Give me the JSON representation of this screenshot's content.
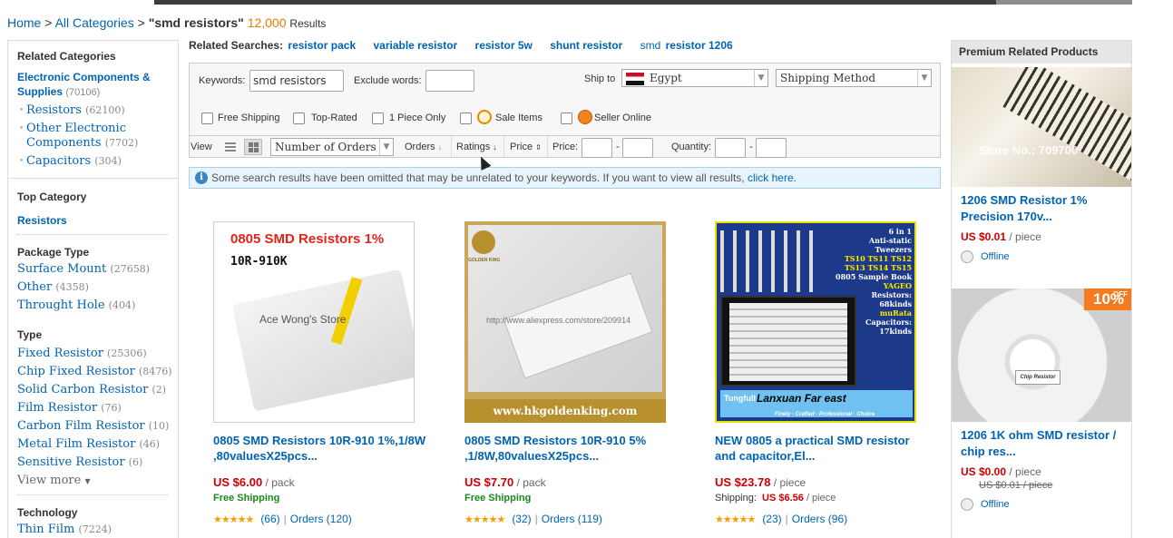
{
  "breadcrumb": {
    "home": "Home",
    "sep1": ">",
    "all_categories": "All Categories",
    "sep2": ">",
    "query": "\"smd resistors\"",
    "count": "12,000",
    "results_label": "Results"
  },
  "sidebar": {
    "related_heading": "Related Categories",
    "main_category": {
      "label": "Electronic Components & Supplies",
      "count": "(70106)"
    },
    "sub_categories": [
      {
        "label": "Resistors",
        "count": "(62100)"
      },
      {
        "label": "Other Electronic Components",
        "count": "(7702)"
      },
      {
        "label": "Capacitors",
        "count": "(304)"
      }
    ],
    "top_category_heading": "Top Category",
    "top_category": "Resistors",
    "package_heading": "Package Type",
    "package": [
      {
        "label": "Surface Mount",
        "count": "(27658)"
      },
      {
        "label": "Other",
        "count": "(4358)"
      },
      {
        "label": "Throught Hole",
        "count": "(404)"
      }
    ],
    "type_heading": "Type",
    "types": [
      {
        "label": "Fixed Resistor",
        "count": "(25306)"
      },
      {
        "label": "Chip Fixed Resistor",
        "count": "(8476)"
      },
      {
        "label": "Solid Carbon Resistor",
        "count": "(2)"
      },
      {
        "label": "Film Resistor",
        "count": "(76)"
      },
      {
        "label": "Carbon Film Resistor",
        "count": "(10)"
      },
      {
        "label": "Metal Film Resistor",
        "count": "(46)"
      },
      {
        "label": "Sensitive Resistor",
        "count": "(6)"
      }
    ],
    "view_more": "View more",
    "technology_heading": "Technology",
    "technology": [
      {
        "label": "Thin Film",
        "count": "(7224)"
      }
    ]
  },
  "related_searches": {
    "label": "Related Searches:",
    "items": [
      "resistor pack",
      "variable resistor",
      "resistor 5w",
      "shunt resistor",
      "smd",
      "resistor 1206"
    ]
  },
  "filters": {
    "keywords_label": "Keywords:",
    "keywords_value": "smd resistors",
    "exclude_label": "Exclude words:",
    "exclude_value": "",
    "ship_to_label": "Ship to",
    "ship_to_value": "Egypt",
    "shipping_method": "Shipping Method",
    "checkboxes": [
      "Free Shipping",
      "Top-Rated",
      "1 Piece Only",
      "Sale Items",
      "Seller Online"
    ],
    "view_label": "View",
    "sort_select": "Number of Orders",
    "sort_orders": "Orders",
    "sort_ratings": "Ratings",
    "sort_price": "Price",
    "price_label": "Price:",
    "dash": "-",
    "quantity_label": "Quantity:"
  },
  "notice": {
    "text": "Some search results have been omitted that may be unrelated to your keywords. If you want to view all results,",
    "link": "click here."
  },
  "products": [
    {
      "title": "0805 SMD Resistors 10R-910 1%,1/8W ,80valuesX25pcs...",
      "price": "US $6.00",
      "unit": "/ pack",
      "shipping": "Free Shipping",
      "reviews": "(66)",
      "orders": "Orders (120)",
      "img_headline": "0805 SMD Resistors 1%",
      "img_sub": "10R-910K",
      "img_watermark": "Ace Wong's Store"
    },
    {
      "title": "0805 SMD Resistors 10R-910 5% ,1/8W,80valuesX25pcs...",
      "price": "US $7.70",
      "unit": "/ pack",
      "shipping": "Free Shipping",
      "reviews": "(32)",
      "orders": "Orders (119)",
      "img_brand": "GOLDEN KING",
      "img_url": "http://www.aliexpress.com/store/209914",
      "img_footer": "www.hkgoldenking.com"
    },
    {
      "title": "NEW 0805 a practical SMD resistor and capacitor,El...",
      "price": "US $23.78",
      "unit": "/ piece",
      "shipping_label": "Shipping:",
      "shipping_cost": "US $6.56",
      "shipping_unit": "/ piece",
      "reviews": "(23)",
      "orders": "Orders (96)",
      "img_lines": [
        "6 in 1",
        "Anti-static",
        "Tweezers",
        "TS10 TS11 TS12",
        "TS13 TS14 TS15",
        "0805 Sample Book",
        "YAGEO",
        "Resistors:",
        "68kinds",
        "muRata",
        "Capacitors:",
        "17kinds"
      ],
      "img_banner": "Lanxuan Far east",
      "img_brand": "Tungfull",
      "img_tagline": "Finely · Crafted · Professional · Choice"
    }
  ],
  "premium": {
    "heading": "Premium Related Products",
    "items": [
      {
        "title": "1206 SMD Resistor 1% Precision 170v...",
        "price": "US $0.01",
        "unit": "/ piece",
        "status": "Offline",
        "img_watermark": "Store No.: 709700"
      },
      {
        "title": "1206 1K ohm SMD resistor / chip res...",
        "price": "US $0.00",
        "unit": "/ piece",
        "old_price": "US $0.01 / piece",
        "status": "Offline",
        "badge": "10%",
        "badge_small": "OFF",
        "img_label": "Chip Resistor"
      }
    ]
  },
  "colors": {
    "link": "#0063b3",
    "price": "#cc0000",
    "count": "#e67a00",
    "free_shipping": "#1a8a1a"
  }
}
